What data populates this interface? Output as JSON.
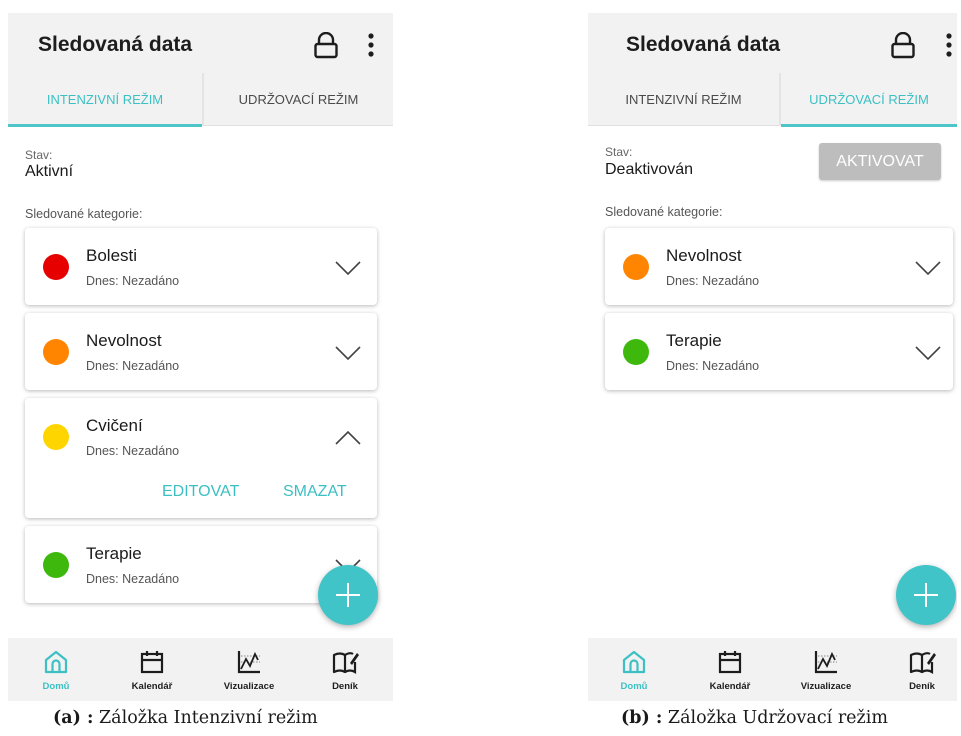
{
  "screen_a": {
    "title": "Sledovaná data",
    "tabs": [
      {
        "label": "INTENZIVNÍ REŽIM",
        "active": true
      },
      {
        "label": "UDRŽOVACÍ REŽIM",
        "active": false
      }
    ],
    "state_label": "Stav:",
    "state_value": "Aktivní",
    "section_label": "Sledované kategorie:",
    "categories": [
      {
        "name": "Bolesti",
        "subtitle": "Dnes: Nezadáno",
        "color": "#e60000",
        "expanded": false
      },
      {
        "name": "Nevolnost",
        "subtitle": "Dnes: Nezadáno",
        "color": "#ff8400",
        "expanded": false
      },
      {
        "name": "Cvičení",
        "subtitle": "Dnes: Nezadáno",
        "color": "#ffd500",
        "expanded": true,
        "actions": [
          "EDITOVAT",
          "SMAZAT"
        ]
      },
      {
        "name": "Terapie",
        "subtitle": "Dnes: Nezadáno",
        "color": "#3eb80d",
        "expanded": false
      }
    ],
    "fab_icon": "plus-icon",
    "nav": [
      {
        "label": "Domů",
        "icon": "home-icon",
        "active": true
      },
      {
        "label": "Kalendář",
        "icon": "calendar-icon",
        "active": false
      },
      {
        "label": "Vizualizace",
        "icon": "chart-icon",
        "active": false
      },
      {
        "label": "Deník",
        "icon": "diary-icon",
        "active": false
      }
    ],
    "caption_tag": "(a) :",
    "caption_text": " Záložka Intenzivní režim"
  },
  "screen_b": {
    "title": "Sledovaná data",
    "tabs": [
      {
        "label": "INTENZIVNÍ REŽIM",
        "active": false
      },
      {
        "label": "UDRŽOVACÍ REŽIM",
        "active": true
      }
    ],
    "state_label": "Stav:",
    "state_value": "Deaktivován",
    "activate_label": "AKTIVOVAT",
    "section_label": "Sledované kategorie:",
    "categories": [
      {
        "name": "Nevolnost",
        "subtitle": "Dnes: Nezadáno",
        "color": "#ff8400",
        "expanded": false
      },
      {
        "name": "Terapie",
        "subtitle": "Dnes: Nezadáno",
        "color": "#3eb80d",
        "expanded": false
      }
    ],
    "fab_icon": "plus-icon",
    "nav": [
      {
        "label": "Domů",
        "icon": "home-icon",
        "active": true
      },
      {
        "label": "Kalendář",
        "icon": "calendar-icon",
        "active": false
      },
      {
        "label": "Vizualizace",
        "icon": "chart-icon",
        "active": false
      },
      {
        "label": "Deník",
        "icon": "diary-icon",
        "active": false
      }
    ],
    "caption_tag": "(b) :",
    "caption_text": " Záložka Udržovací režim"
  },
  "colors": {
    "accent": "#3cc0c4",
    "fab": "#40c4c8",
    "appbar": "#f2f2f2",
    "disabled_button": "#bdbdbd"
  }
}
